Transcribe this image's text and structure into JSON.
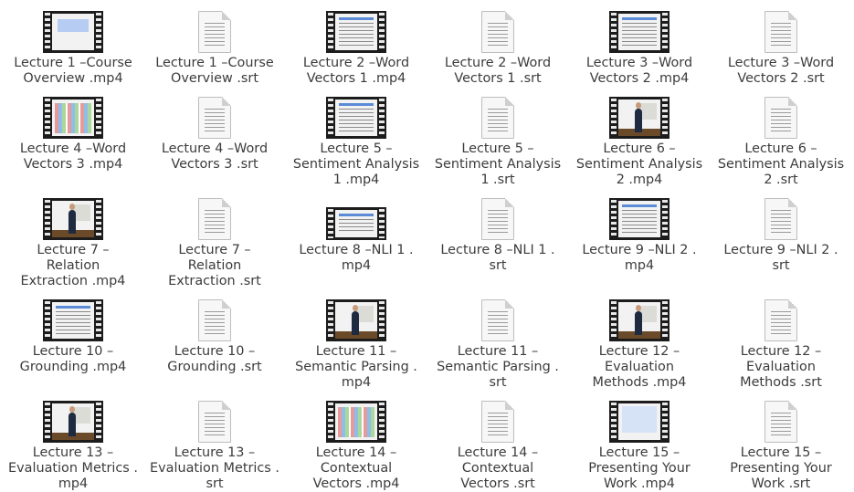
{
  "files": [
    {
      "label": "Lecture 1 –Course\nOverview .mp4",
      "type": "video",
      "icon": "film-icon",
      "thumb": "slide-blue"
    },
    {
      "label": "Lecture 1 –Course\nOverview .srt",
      "type": "text",
      "icon": "document-icon"
    },
    {
      "label": "Lecture 2 –Word\nVectors 1 .mp4",
      "type": "video",
      "icon": "film-icon",
      "thumb": "slide-white"
    },
    {
      "label": "Lecture 2 –Word\nVectors 1 .srt",
      "type": "text",
      "icon": "document-icon"
    },
    {
      "label": "Lecture 3 –Word\nVectors 2 .mp4",
      "type": "video",
      "icon": "film-icon",
      "thumb": "slide-white"
    },
    {
      "label": "Lecture 3 –Word\nVectors 2 .srt",
      "type": "text",
      "icon": "document-icon"
    },
    {
      "label": "Lecture 4 –Word\nVectors 3 .mp4",
      "type": "video",
      "icon": "film-icon",
      "thumb": "slide-color"
    },
    {
      "label": "Lecture 4 –Word\nVectors 3 .srt",
      "type": "text",
      "icon": "document-icon"
    },
    {
      "label": "Lecture 5 –\nSentiment Analysis\n1 .mp4",
      "type": "video",
      "icon": "film-icon",
      "thumb": "slide-white"
    },
    {
      "label": "Lecture 5 –\nSentiment Analysis\n1 .srt",
      "type": "text",
      "icon": "document-icon"
    },
    {
      "label": "Lecture 6 –\nSentiment Analysis\n2 .mp4",
      "type": "video",
      "icon": "film-icon",
      "thumb": "room"
    },
    {
      "label": "Lecture 6 –\nSentiment Analysis\n2 .srt",
      "type": "text",
      "icon": "document-icon"
    },
    {
      "label": "Lecture 7 –\nRelation\nExtraction .mp4",
      "type": "video",
      "icon": "film-icon",
      "thumb": "room"
    },
    {
      "label": "Lecture 7 –\nRelation\nExtraction .srt",
      "type": "text",
      "icon": "document-icon"
    },
    {
      "label": "Lecture 8 –NLI 1 .\nmp4",
      "type": "video",
      "icon": "film-icon",
      "thumb": "slide-white",
      "wide": true
    },
    {
      "label": "Lecture 8 –NLI 1 .\nsrt",
      "type": "text",
      "icon": "document-icon"
    },
    {
      "label": "Lecture 9 –NLI 2 .\nmp4",
      "type": "video",
      "icon": "film-icon",
      "thumb": "slide-white"
    },
    {
      "label": "Lecture 9 –NLI 2 .\nsrt",
      "type": "text",
      "icon": "document-icon"
    },
    {
      "label": "Lecture 10 –\nGrounding .mp4",
      "type": "video",
      "icon": "film-icon",
      "thumb": "slide-white"
    },
    {
      "label": "Lecture 10 –\nGrounding .srt",
      "type": "text",
      "icon": "document-icon"
    },
    {
      "label": "Lecture 11 –\nSemantic Parsing .\nmp4",
      "type": "video",
      "icon": "film-icon",
      "thumb": "room"
    },
    {
      "label": "Lecture 11 –\nSemantic Parsing .\nsrt",
      "type": "text",
      "icon": "document-icon"
    },
    {
      "label": "Lecture 12 –\nEvaluation\nMethods .mp4",
      "type": "video",
      "icon": "film-icon",
      "thumb": "room"
    },
    {
      "label": "Lecture 12 –\nEvaluation\nMethods .srt",
      "type": "text",
      "icon": "document-icon"
    },
    {
      "label": "Lecture 13 –\nEvaluation Metrics .\nmp4",
      "type": "video",
      "icon": "film-icon",
      "thumb": "room"
    },
    {
      "label": "Lecture 13 –\nEvaluation Metrics .\nsrt",
      "type": "text",
      "icon": "document-icon"
    },
    {
      "label": "Lecture 14 –\nContextual\nVectors .mp4",
      "type": "video",
      "icon": "film-icon",
      "thumb": "slide-color"
    },
    {
      "label": "Lecture 14 –\nContextual\nVectors .srt",
      "type": "text",
      "icon": "document-icon"
    },
    {
      "label": "Lecture 15 –\nPresenting Your\nWork .mp4",
      "type": "video",
      "icon": "film-icon",
      "thumb": "bluescreen"
    },
    {
      "label": "Lecture 15 –\nPresenting Your\nWork .srt",
      "type": "text",
      "icon": "document-icon"
    }
  ]
}
